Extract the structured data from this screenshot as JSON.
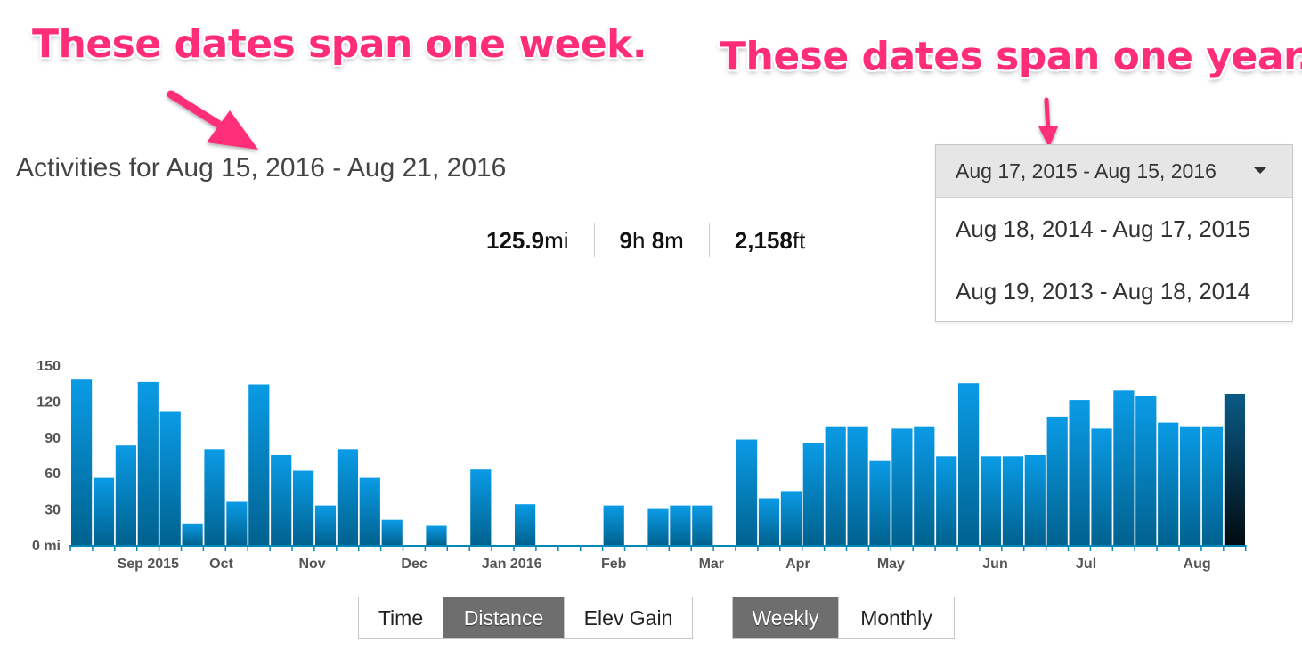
{
  "annotations": {
    "week": "These dates span one week.",
    "year": "These dates span one year."
  },
  "header": {
    "title": "Activities for Aug 15, 2016 - Aug 21, 2016"
  },
  "stats": {
    "distance_value": "125.9",
    "distance_unit": "mi",
    "time_hours": "9",
    "time_h_unit": "h",
    "time_minutes": "8",
    "time_m_unit": "m",
    "elev_value": "2,158",
    "elev_unit": "ft"
  },
  "date_range": {
    "selected": "Aug 17, 2015 - Aug 15, 2016",
    "options": [
      "Aug 18, 2014 - Aug 17, 2015",
      "Aug 19, 2013 - Aug 18, 2014"
    ]
  },
  "toggles": {
    "metrics": [
      "Time",
      "Distance",
      "Elev Gain"
    ],
    "metric_active": "Distance",
    "periods": [
      "Weekly",
      "Monthly"
    ],
    "period_active": "Weekly"
  },
  "colors": {
    "accent": "#ff2d78",
    "bar": "#0a9be6",
    "bar_dark": "#005a8c",
    "bar_selected": "#0b1d2a",
    "axis": "#0088bb"
  },
  "chart_data": {
    "type": "bar",
    "ylim": [
      0,
      150
    ],
    "y_ticks": [
      "0 mi",
      "30",
      "60",
      "90",
      "120",
      "150"
    ],
    "y_tick_values": [
      0,
      30,
      60,
      90,
      120,
      150
    ],
    "x_month_labels": [
      {
        "label": "Sep 2015",
        "week_index": 3
      },
      {
        "label": "Oct",
        "week_index": 6.3
      },
      {
        "label": "Nov",
        "week_index": 10.4
      },
      {
        "label": "Dec",
        "week_index": 15
      },
      {
        "label": "Jan 2016",
        "week_index": 19.4
      },
      {
        "label": "Feb",
        "week_index": 24
      },
      {
        "label": "Mar",
        "week_index": 28.4
      },
      {
        "label": "Apr",
        "week_index": 32.3
      },
      {
        "label": "May",
        "week_index": 36.5
      },
      {
        "label": "Jun",
        "week_index": 41.2
      },
      {
        "label": "Jul",
        "week_index": 45.3
      },
      {
        "label": "Aug",
        "week_index": 50.3
      }
    ],
    "values": [
      138,
      56,
      83,
      136,
      111,
      18,
      80,
      36,
      134,
      75,
      62,
      33,
      80,
      56,
      21,
      0,
      16,
      0,
      63,
      0,
      34,
      0,
      0,
      0,
      33,
      0,
      30,
      33,
      33,
      0,
      88,
      39,
      45,
      85,
      99,
      99,
      70,
      97,
      99,
      74,
      135,
      74,
      74,
      75,
      107,
      121,
      97,
      129,
      124,
      102,
      99,
      99,
      126
    ],
    "selected_index": 52
  }
}
